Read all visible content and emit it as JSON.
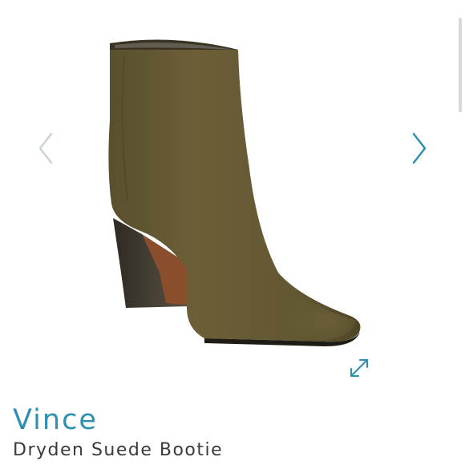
{
  "product": {
    "brand": "Vince",
    "name": "Dryden Suede Bootie"
  },
  "colors": {
    "brand_text": "#2e8fb0",
    "name_text": "#3a3a3a",
    "arrow_prev": "#c9d3d8",
    "arrow_next": "#2e8fb0",
    "expand_icon": "#2e8fb0",
    "suede": "#5d5230"
  },
  "gallery": {
    "prev_icon": "chevron-left-icon",
    "next_icon": "chevron-right-icon",
    "expand_icon": "expand-arrows-icon"
  }
}
